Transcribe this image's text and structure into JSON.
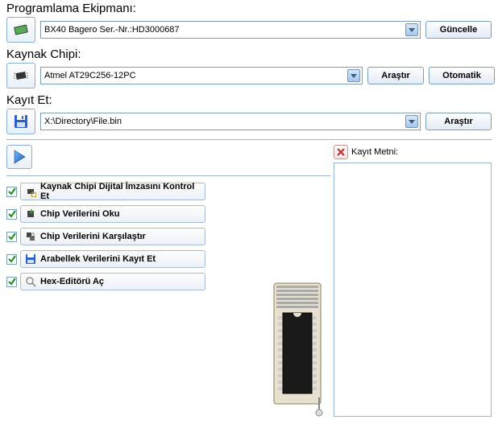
{
  "equipment": {
    "label": "Programlama Ekipmanı:",
    "value": "BX40 Bagero Ser.-Nr.:HD3000687",
    "update_btn": "Güncelle"
  },
  "source_chip": {
    "label": "Kaynak Chipi:",
    "value": "Atmel AT29C256-12PC",
    "search_btn": "Araştır",
    "auto_btn": "Otomatik"
  },
  "save": {
    "label": "Kayıt Et:",
    "value": "X:\\Directory\\File.bin",
    "search_btn": "Araştır"
  },
  "steps": [
    {
      "label": "Kaynak Chipi Dijital İmzasını Kontrol Et"
    },
    {
      "label": "Chip Verilerini Oku"
    },
    {
      "label": "Chip Verilerini Karşılaştır"
    },
    {
      "label": "Arabellek Verilerini Kayıt Et"
    },
    {
      "label": "Hex-Editörü Aç"
    }
  ],
  "log": {
    "header": "Kayıt Metni:"
  }
}
